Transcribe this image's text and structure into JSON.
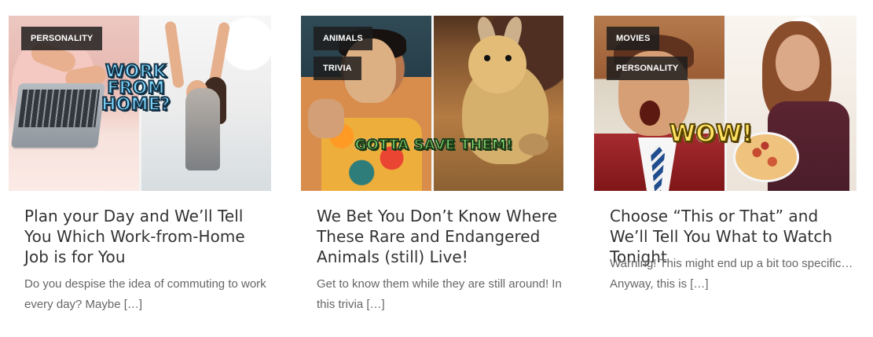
{
  "cards": [
    {
      "tags": [
        "PERSONALITY"
      ],
      "image_text": "WORK FROM HOME?",
      "title": "Plan your Day and We’ll Tell You Which Work-from-Home Job is for You",
      "excerpt": "Do you despise the idea of commuting to work every day? Maybe […]"
    },
    {
      "tags": [
        "ANIMALS",
        "TRIVIA"
      ],
      "image_text": "GOTTA SAVE THEM!",
      "title": "We Bet You Don’t Know Where These Rare and Endangered Animals (still) Live!",
      "excerpt": "Get to know them while they are still around! In this trivia […]"
    },
    {
      "tags": [
        "MOVIES",
        "PERSONALITY"
      ],
      "image_text": "WOW!",
      "title": "Choose “This or That” and We’ll Tell You What to Watch Tonight",
      "excerpt": "Warning! This might end up a bit too specific… Anyway, this is […]"
    }
  ]
}
